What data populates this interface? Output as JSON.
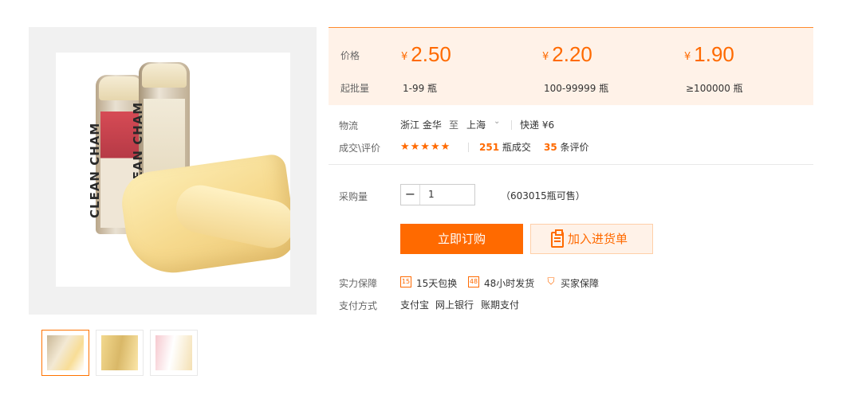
{
  "gallery": {
    "main_image_text": "CLEAN CHAM",
    "thumbnails": [
      {
        "name": "thumb-1"
      },
      {
        "name": "thumb-2"
      },
      {
        "name": "thumb-3"
      }
    ]
  },
  "pricing": {
    "price_label": "价格",
    "moq_label": "起批量",
    "currency": "¥",
    "tiers": [
      {
        "price": "2.50",
        "range": "1-99 瓶"
      },
      {
        "price": "2.20",
        "range": "100-99999 瓶"
      },
      {
        "price": "1.90",
        "range": "≥100000 瓶"
      }
    ]
  },
  "logistics": {
    "label": "物流",
    "from": "浙江 金华",
    "to_word": "至",
    "to": "上海",
    "shipping": "快递 ¥6"
  },
  "reviews": {
    "label": "成交\\评价",
    "stars": "★★★★★",
    "rating": 4.5,
    "deals_count": "251",
    "deals_unit": "瓶成交",
    "review_count": "35",
    "review_unit": "条评价"
  },
  "purchase": {
    "label": "采购量",
    "minus": "−",
    "quantity": "1",
    "available": "（603015瓶可售）",
    "buy_button": "立即订购",
    "cart_button": "加入进货单"
  },
  "guarantee": {
    "label": "实力保障",
    "items": [
      {
        "icon": "15",
        "text": "15天包换"
      },
      {
        "icon": "48",
        "text": "48小时发货"
      },
      {
        "icon": "保",
        "text": "买家保障"
      }
    ]
  },
  "payment": {
    "label": "支付方式",
    "methods": [
      "支付宝",
      "网上银行",
      "账期支付"
    ]
  },
  "colors": {
    "accent": "#ff6a00",
    "price_bg": "#fff2e8"
  }
}
